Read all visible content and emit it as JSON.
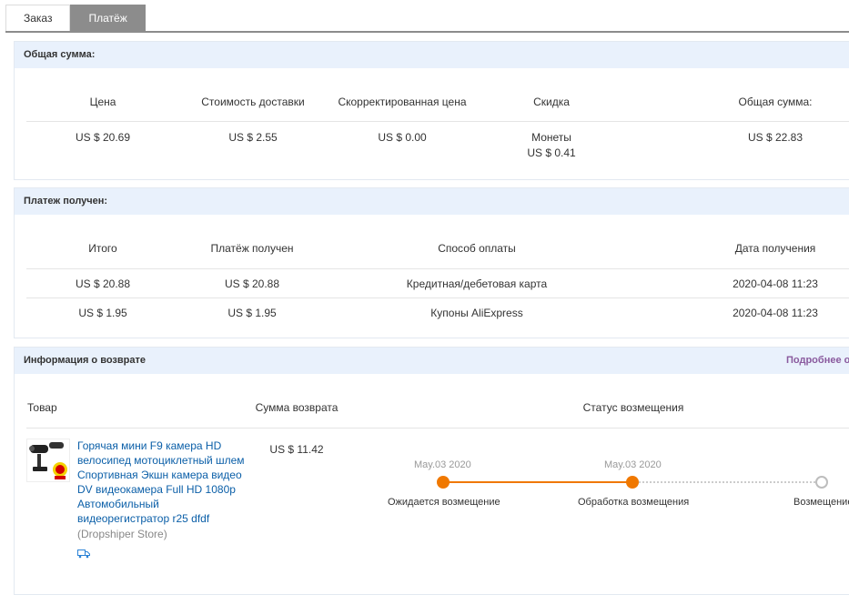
{
  "tabs": [
    {
      "label": "Заказ",
      "active": false
    },
    {
      "label": "Платёж",
      "active": true
    }
  ],
  "total": {
    "title": "Общая сумма:",
    "headers": [
      "Цена",
      "Стоимость доставки",
      "Скорректированная цена",
      "Скидка",
      "Общая сумма:"
    ],
    "values": {
      "price": "US $ 20.69",
      "shipping": "US $ 2.55",
      "adjusted": "US $ 0.00",
      "discount_label": "Монеты",
      "discount_value": "US $ 0.41",
      "total": "US $ 22.83"
    }
  },
  "payment": {
    "title": "Платеж получен:",
    "headers": [
      "Итого",
      "Платёж получен",
      "Способ оплаты",
      "Дата получения"
    ],
    "rows": [
      [
        "US $ 20.88",
        "US $ 20.88",
        "Кредитная/дебетовая карта",
        "2020-04-08 11:23"
      ],
      [
        "US $ 1.95",
        "US $ 1.95",
        "Купоны AliExpress",
        "2020-04-08 11:23"
      ]
    ]
  },
  "refund": {
    "title": "Информация о возврате",
    "more_link": "Подробнее о",
    "headers": [
      "Товар",
      "Сумма возврата",
      "Статус возмещения"
    ],
    "product": {
      "title": "Горячая мини F9 камера HD велосипед мотоциклетный шлем Спортивная Экшн камера видео DV видеокамера Full HD 1080p Автомобильный видеорегистратор r25 dfdf",
      "store": "(Dropshiper Store)",
      "icon": "truck-icon"
    },
    "amount": "US $ 11.42",
    "timeline": [
      {
        "date": "May.03 2020",
        "label": "Ожидается возмещение",
        "status": "done"
      },
      {
        "date": "May.03 2020",
        "label": "Обработка возмещения",
        "status": "done"
      },
      {
        "date": "",
        "label": "Возмещение",
        "status": "pending"
      }
    ]
  },
  "colors": {
    "accent": "#f07800",
    "link": "#0b5fa8",
    "panel_header": "#e9f1fc",
    "tab_active": "#8c8c8c",
    "more_link": "#8a5a9e"
  }
}
